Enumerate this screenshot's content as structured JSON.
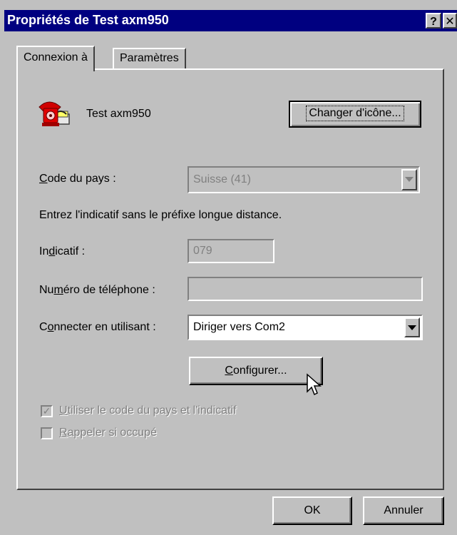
{
  "window": {
    "title": "Propriétés de Test axm950",
    "help_button": "?",
    "close_button": "✕"
  },
  "tabs": [
    {
      "label": "Connexion à",
      "active": true
    },
    {
      "label": "Paramètres",
      "active": false
    }
  ],
  "connection": {
    "icon": "phone-icon",
    "name": "Test axm950",
    "change_icon_button": "Changer d'icône..."
  },
  "country": {
    "label_pre": "",
    "label_key": "C",
    "label_post": "ode du pays :",
    "value": "Suisse (41)"
  },
  "instruction": "Entrez l'indicatif sans le préfixe longue distance.",
  "area_code": {
    "label_pre": "In",
    "label_key": "d",
    "label_post": "icatif :",
    "value": "079"
  },
  "phone_number": {
    "label_pre": "Nu",
    "label_key": "m",
    "label_post": "éro de téléphone :",
    "value": ""
  },
  "connect_using": {
    "label_pre": "C",
    "label_key": "o",
    "label_post": "nnecter en utilisant :",
    "value": "Diriger vers Com2"
  },
  "configure_button": {
    "pre": "",
    "key": "C",
    "post": "onfigurer..."
  },
  "checkboxes": [
    {
      "pre": "",
      "key": "U",
      "post": "tiliser le code du pays et l'indicatif",
      "checked": true
    },
    {
      "pre": "",
      "key": "R",
      "post": "appeler si occupé",
      "checked": false
    }
  ],
  "footer": {
    "ok": "OK",
    "cancel": "Annuler"
  }
}
